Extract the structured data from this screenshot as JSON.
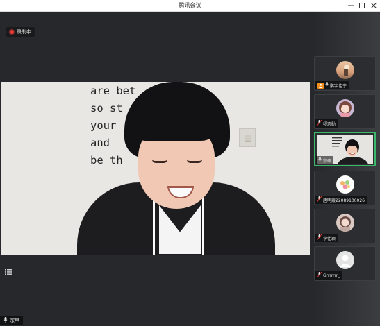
{
  "window": {
    "title": "腾讯会议",
    "controls": [
      "minimize-icon",
      "maximize-icon",
      "close-icon"
    ]
  },
  "recording": {
    "label": "录制中",
    "icon": "record-dot-icon",
    "color": "#e53935"
  },
  "main_video": {
    "wall_text_lines": [
      "are bet    n you",
      "so st         ng",
      "your           rs",
      "and",
      "be th        u can"
    ],
    "speaker_label": "宗申"
  },
  "participants": [
    {
      "name": "鹏宇佳宁",
      "audio_icon": "mic-icon",
      "host_icon": "user-icon",
      "host_color": "#f28c1b"
    },
    {
      "name": "杨志勋",
      "audio_icon": "mic-muted-icon"
    },
    {
      "name": "宗申",
      "audio_icon": "mic-icon",
      "active": true,
      "active_color": "#3bb86a"
    },
    {
      "name": "唐明霞22089100026",
      "audio_icon": "mic-muted-icon"
    },
    {
      "name": "李佳颖",
      "audio_icon": "mic-muted-icon"
    },
    {
      "name": "Grrrrrrr_",
      "audio_icon": "mic-muted-icon"
    }
  ]
}
